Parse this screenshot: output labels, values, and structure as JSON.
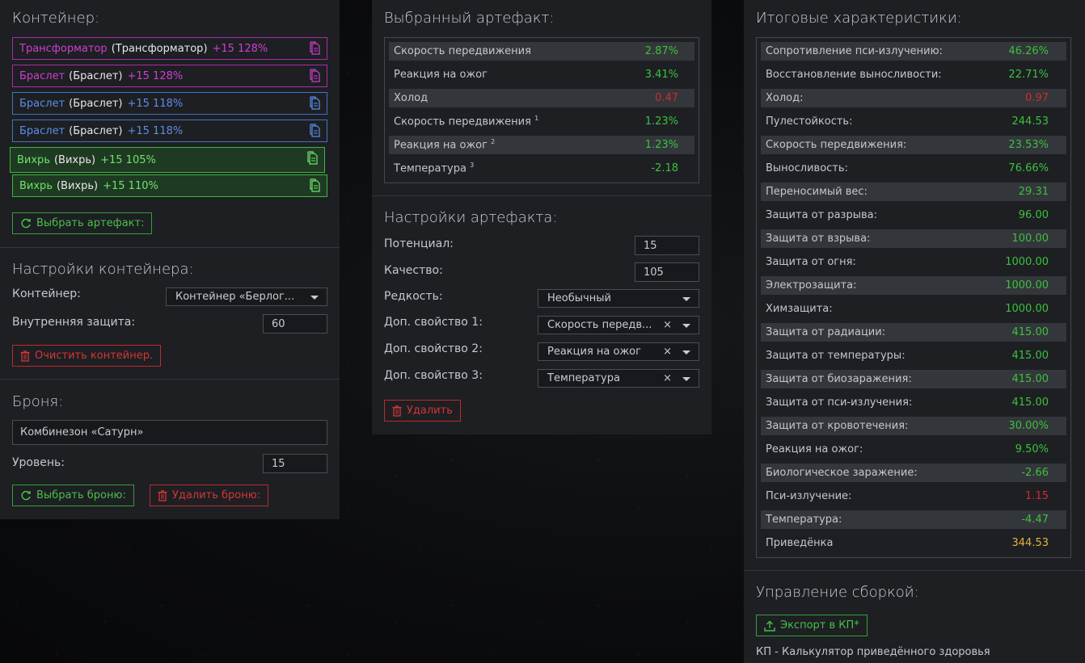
{
  "colors": {
    "accent_green": "#3cc13c",
    "accent_red": "#d12c2c",
    "gold": "#e2b43a",
    "purple": "#cf3fd0",
    "blue": "#5b8ee8"
  },
  "container": {
    "title": "Контейнер:",
    "slots": [
      {
        "name": "Трансформатор",
        "sub": "(Трансформатор)",
        "bonus": "+15 128%",
        "rarity": "purple",
        "icon": "copy-icon"
      },
      {
        "name": "Браслет",
        "sub": "(Браслет)",
        "bonus": "+15 128%",
        "rarity": "purple",
        "icon": "copy-icon"
      },
      {
        "name": "Браслет",
        "sub": "(Браслет)",
        "bonus": "+15 118%",
        "rarity": "blue",
        "icon": "copy-icon"
      },
      {
        "name": "Браслет",
        "sub": "(Браслет)",
        "bonus": "+15 118%",
        "rarity": "blue",
        "icon": "copy-icon"
      },
      {
        "name": "Вихрь",
        "sub": "(Вихрь)",
        "bonus": "+15 105%",
        "rarity": "green",
        "icon": "copy-icon"
      },
      {
        "name": "Вихрь",
        "sub": "(Вихрь)",
        "bonus": "+15 110%",
        "rarity": "green",
        "icon": "copy-icon"
      }
    ],
    "select_button": "Выбрать артефакт:"
  },
  "container_settings": {
    "title": "Настройки контейнера:",
    "container_label": "Контейнер:",
    "container_value": "Контейнер «Берлог...",
    "inner_protection_label": "Внутренняя защита:",
    "inner_protection_value": "60",
    "clear_button": "Очистить контейнер."
  },
  "armor": {
    "title": "Броня:",
    "value": "Комбинезон «Сатурн»",
    "level_label": "Уровень:",
    "level_value": "15",
    "select_button": "Выбрать броню:",
    "delete_button": "Удалить броню:"
  },
  "selected_artifact": {
    "title": "Выбранный артефакт:",
    "rows": [
      {
        "key": "Скорость передвижения",
        "sup": "",
        "value": "2.87%",
        "tone": "pos"
      },
      {
        "key": "Реакция на ожог",
        "sup": "",
        "value": "3.41%",
        "tone": "pos"
      },
      {
        "key": "Холод",
        "sup": "",
        "value": "0.47",
        "tone": "neg"
      },
      {
        "key": "Скорость передвижения",
        "sup": "1",
        "value": "1.23%",
        "tone": "pos"
      },
      {
        "key": "Реакция на ожог",
        "sup": "2",
        "value": "1.23%",
        "tone": "pos"
      },
      {
        "key": "Температура",
        "sup": "3",
        "value": "-2.18",
        "tone": "pos"
      }
    ]
  },
  "artifact_settings": {
    "title": "Настройки артефакта:",
    "potential_label": "Потенциал:",
    "potential_value": "15",
    "quality_label": "Качество:",
    "quality_value": "105",
    "rarity_label": "Редкость:",
    "rarity_value": "Необычный",
    "extra1_label": "Доп. свойство 1:",
    "extra1_value": "Скорость передв...",
    "extra2_label": "Доп. свойство 2:",
    "extra2_value": "Реакция на ожог",
    "extra3_label": "Доп. свойство 3:",
    "extra3_value": "Температура",
    "clear_glyph": "×",
    "delete_button": "Удалить"
  },
  "totals": {
    "title": "Итоговые характеристики:",
    "rows": [
      {
        "key": "Сопротивление пси-излучению:",
        "value": "46.26%",
        "tone": "pos"
      },
      {
        "key": "Восстановление выносливости:",
        "value": "22.71%",
        "tone": "pos"
      },
      {
        "key": "Холод:",
        "value": "0.97",
        "tone": "neg"
      },
      {
        "key": "Пулестойкость:",
        "value": "244.53",
        "tone": "pos"
      },
      {
        "key": "Скорость передвижения:",
        "value": "23.53%",
        "tone": "pos"
      },
      {
        "key": "Выносливость:",
        "value": "76.66%",
        "tone": "pos"
      },
      {
        "key": "Переносимый вес:",
        "value": "29.31",
        "tone": "pos"
      },
      {
        "key": "Защита от разрыва:",
        "value": "96.00",
        "tone": "pos"
      },
      {
        "key": "Защита от взрыва:",
        "value": "100.00",
        "tone": "pos"
      },
      {
        "key": "Защита от огня:",
        "value": "1000.00",
        "tone": "pos"
      },
      {
        "key": "Электрозащита:",
        "value": "1000.00",
        "tone": "pos"
      },
      {
        "key": "Химзащита:",
        "value": "1000.00",
        "tone": "pos"
      },
      {
        "key": "Защита от радиации:",
        "value": "415.00",
        "tone": "pos"
      },
      {
        "key": "Защита от температуры:",
        "value": "415.00",
        "tone": "pos"
      },
      {
        "key": "Защита от биозаражения:",
        "value": "415.00",
        "tone": "pos"
      },
      {
        "key": "Защита от пси-излучения:",
        "value": "415.00",
        "tone": "pos"
      },
      {
        "key": "Защита от кровотечения:",
        "value": "30.00%",
        "tone": "pos"
      },
      {
        "key": "Реакция на ожог:",
        "value": "9.50%",
        "tone": "pos"
      },
      {
        "key": "Биологическое заражение:",
        "value": "-2.66",
        "tone": "pos"
      },
      {
        "key": "Пси-излучение:",
        "value": "1.15",
        "tone": "neg"
      },
      {
        "key": "Температура:",
        "value": "-4.47",
        "tone": "pos"
      },
      {
        "key": "Приведёнка",
        "value": "344.53",
        "tone": "gold"
      }
    ]
  },
  "build": {
    "title": "Управление сборкой:",
    "export_button": "Экспорт в КП*",
    "note": "КП - Калькулятор приведённого здоровья"
  }
}
